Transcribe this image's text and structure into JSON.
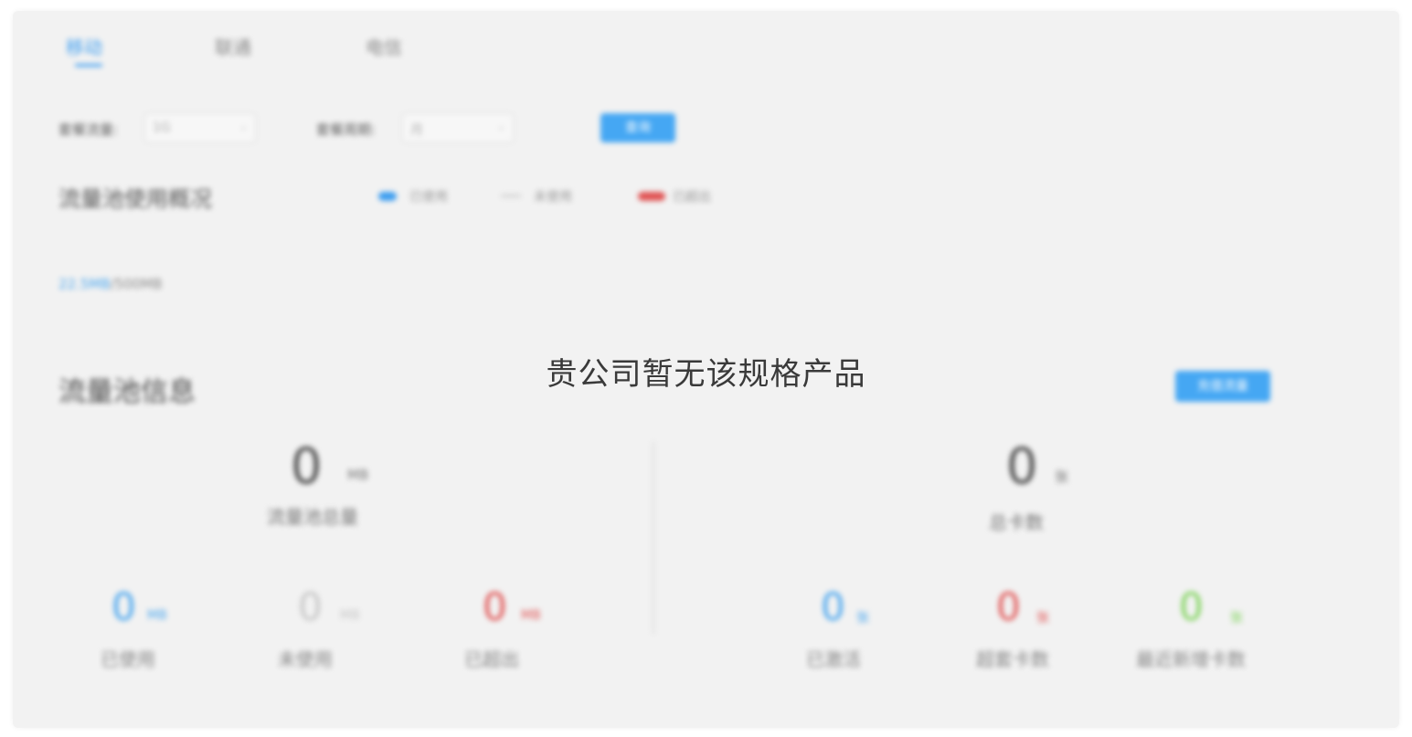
{
  "tabs": [
    {
      "label": "移动",
      "active": true
    },
    {
      "label": "联通",
      "active": false
    },
    {
      "label": "电信",
      "active": false
    }
  ],
  "filters": {
    "package_label": "套餐流量:",
    "package_value": "1G",
    "period_label": "套餐周期:",
    "period_value": "月",
    "query_button": "查询"
  },
  "usage_overview": {
    "title": "流量池使用概况",
    "legend": [
      {
        "label": "已使用",
        "color": "#3e9ef0"
      },
      {
        "label": "未使用",
        "color": "#d0d0d0"
      },
      {
        "label": "已超出",
        "color": "#e05555"
      }
    ],
    "used": "22.5MB",
    "separator": "/",
    "total": "500MB"
  },
  "pool_info": {
    "title": "流量池信息",
    "action_button": "充值流量",
    "total_traffic": {
      "value": "0",
      "unit": "MB",
      "label": "流量池总量"
    },
    "total_cards": {
      "value": "0",
      "unit": "张",
      "label": "总卡数"
    },
    "traffic_stats": [
      {
        "value": "0",
        "unit": "MB",
        "label": "已使用",
        "color": "#4aa6ee"
      },
      {
        "value": "0",
        "unit": "MB",
        "label": "未使用",
        "color": "#c6c6c6"
      },
      {
        "value": "0",
        "unit": "MB",
        "label": "已超出",
        "color": "#e05555"
      }
    ],
    "card_stats": [
      {
        "value": "0",
        "unit": "张",
        "label": "已激活",
        "color": "#4aa6ee"
      },
      {
        "value": "0",
        "unit": "张",
        "label": "超套卡数",
        "color": "#e05555"
      },
      {
        "value": "0",
        "unit": "张",
        "label": "最近新增卡数",
        "color": "#7ed35a"
      }
    ]
  },
  "overlay": {
    "message": "贵公司暂无该规格产品"
  }
}
